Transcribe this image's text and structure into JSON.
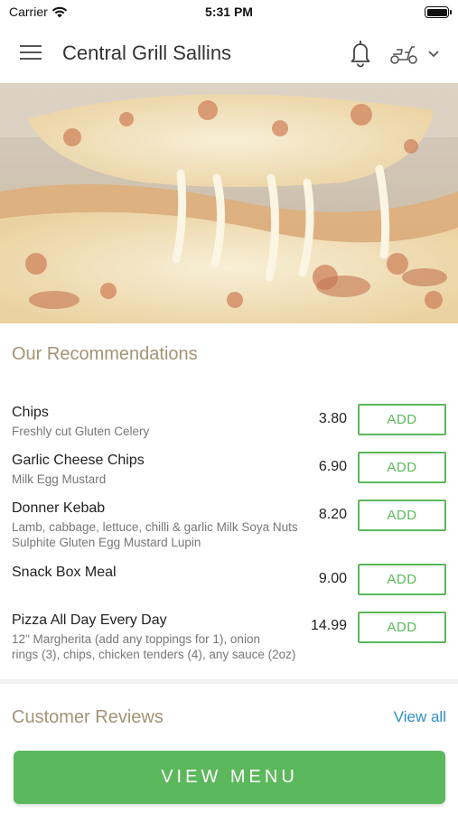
{
  "status_bar": {
    "carrier": "Carrier",
    "time": "5:31 PM"
  },
  "header": {
    "title": "Central Grill Sallins",
    "icons": [
      "menu-icon",
      "bell-icon",
      "scooter-icon",
      "chevron-down-icon"
    ]
  },
  "hero": {
    "icon": "pizza-image"
  },
  "recommendations": {
    "title": "Our Recommendations",
    "add_label": "ADD",
    "items": [
      {
        "name": "Chips",
        "desc_lines": [
          "Freshly cut Gluten Celery"
        ],
        "price": "3.80"
      },
      {
        "name": "Garlic Cheese Chips",
        "desc_lines": [
          "Milk Egg Mustard"
        ],
        "price": "6.90"
      },
      {
        "name": "Donner Kebab",
        "desc_lines": [
          "Lamb, cabbage, lettuce, chilli & garlic Milk Soya Nuts",
          "Sulphite Gluten Egg Mustard Lupin"
        ],
        "price": "8.20"
      },
      {
        "name": "Snack Box Meal",
        "desc_lines": [],
        "price": "9.00"
      },
      {
        "name": "Pizza All Day Every Day",
        "desc_lines": [
          "12\" Margherita (add any toppings for 1), onion",
          "rings (3), chips, chicken tenders (4), any sauce (2oz)"
        ],
        "price": "14.99"
      }
    ]
  },
  "reviews": {
    "title": "Customer Reviews",
    "view_all": "View all"
  },
  "footer": {
    "view_menu": "VIEW MENU"
  },
  "colors": {
    "accent_green": "#5cb85c",
    "section_title": "#a39474",
    "link_blue": "#2d8fc7"
  }
}
